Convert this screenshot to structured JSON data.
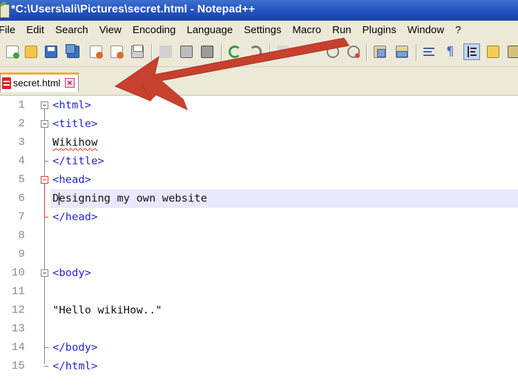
{
  "window": {
    "title": "*C:\\Users\\ali\\Pictures\\secret.html - Notepad++"
  },
  "menu": [
    "File",
    "Edit",
    "Search",
    "View",
    "Encoding",
    "Language",
    "Settings",
    "Macro",
    "Run",
    "Plugins",
    "Window",
    "?"
  ],
  "toolbar": {
    "buttons": [
      "new-file-icon",
      "open-file-icon",
      "save-icon",
      "save-all-icon",
      "close-icon",
      "close-all-icon",
      "print-icon",
      "cut-icon",
      "copy-icon",
      "paste-icon",
      "undo-icon",
      "redo-icon",
      "find-icon",
      "replace-icon",
      "zoom-in-icon",
      "zoom-out-icon",
      "sync-vertical-icon",
      "sync-horizontal-icon",
      "word-wrap-icon",
      "show-all-characters-icon",
      "indent-guide-icon",
      "macro-icon",
      "language-icon"
    ]
  },
  "tabs": [
    {
      "label": "secret.html",
      "active": true,
      "icon": "unsaved-file-icon"
    }
  ],
  "editor": {
    "current_line": 6,
    "lines": [
      {
        "num": "1",
        "text": "<html>",
        "kind": "tag"
      },
      {
        "num": "2",
        "text": "<title>",
        "kind": "tag"
      },
      {
        "num": "3",
        "text": "Wikihow",
        "kind": "text"
      },
      {
        "num": "4",
        "text": "</title>",
        "kind": "tag"
      },
      {
        "num": "5",
        "text": "<head>",
        "kind": "tag"
      },
      {
        "num": "6",
        "text": "Designing my own website",
        "kind": "text"
      },
      {
        "num": "7",
        "text": "</head>",
        "kind": "tag"
      },
      {
        "num": "8",
        "text": "",
        "kind": "text"
      },
      {
        "num": "9",
        "text": "",
        "kind": "text"
      },
      {
        "num": "10",
        "text": "<body>",
        "kind": "tag"
      },
      {
        "num": "11",
        "text": "",
        "kind": "text"
      },
      {
        "num": "12",
        "text": "\"Hello wikiHow..\"",
        "kind": "text"
      },
      {
        "num": "13",
        "text": "",
        "kind": "text"
      },
      {
        "num": "14",
        "text": "</body>",
        "kind": "tag"
      },
      {
        "num": "15",
        "text": "</html>",
        "kind": "tag"
      }
    ]
  },
  "colors": {
    "annotation_arrow": "#c8402e",
    "tag": "#2323d0",
    "current_line": "#e8e8ff"
  }
}
